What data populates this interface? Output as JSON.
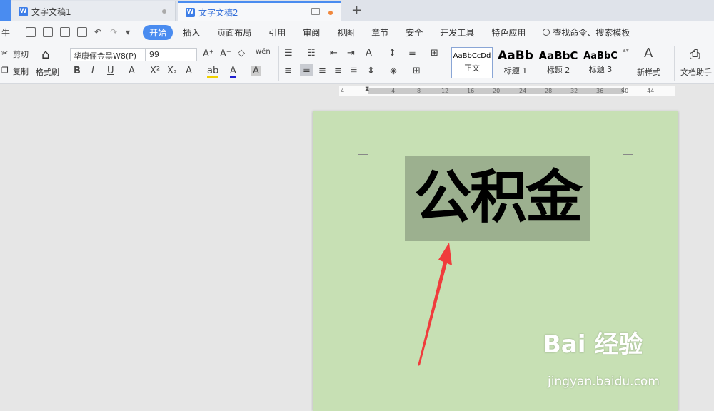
{
  "tabs": [
    {
      "label": "文字文稿1"
    },
    {
      "label": "文字文稿2"
    }
  ],
  "menu": {
    "items": [
      "开始",
      "插入",
      "页面布局",
      "引用",
      "审阅",
      "视图",
      "章节",
      "安全",
      "开发工具",
      "特色应用"
    ],
    "active": "开始",
    "search_label": "查找命令、搜索模板"
  },
  "clipboard": {
    "cut": "剪切",
    "copy": "复制",
    "format_painter": "格式刷"
  },
  "font": {
    "name": "华康俪金黑W8(P)",
    "size": "99"
  },
  "styles": [
    {
      "sample": "AaBbCcDd",
      "label": "正文"
    },
    {
      "sample": "AaBb",
      "label": "标题 1"
    },
    {
      "sample": "AaBbC",
      "label": "标题 2"
    },
    {
      "sample": "AaBbC",
      "label": "标题 3"
    }
  ],
  "new_style": "新样式",
  "doc_helper": "文档助手",
  "ruler_ticks": [
    "4",
    "4",
    "8",
    "12",
    "16",
    "20",
    "24",
    "28",
    "32",
    "36",
    "40",
    "44"
  ],
  "document": {
    "text": "公积金"
  },
  "watermark": {
    "brand": "Bai 经验",
    "url": "jingyan.baidu.com"
  },
  "colors": {
    "accent": "#4a8cf0",
    "page_bg": "#c7e0b4",
    "selection": "#9cb08f",
    "arrow": "#f03c3c"
  }
}
